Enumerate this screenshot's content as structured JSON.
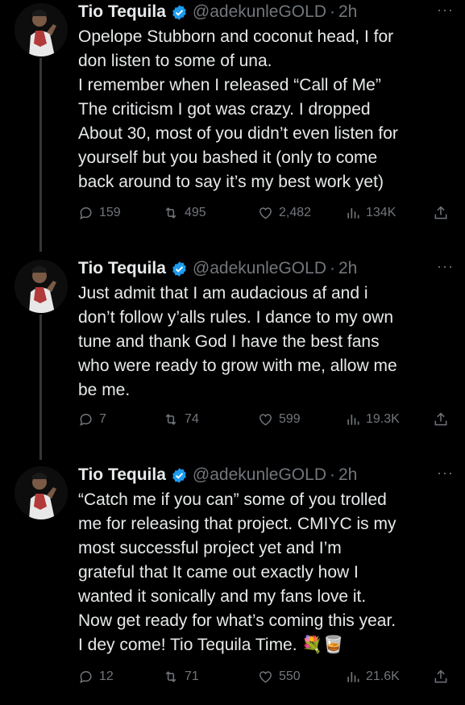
{
  "tweets": [
    {
      "name": "Tio Tequila",
      "handle": "@adekunleGOLD",
      "dot": "·",
      "time": "2h",
      "more": "···",
      "text": "Opelope Stubborn and coconut head, I for\ndon listen to some of una.\nI remember when I released “Call of Me”\nThe criticism I got was crazy. I dropped\nAbout 30, most of you didn’t even listen for\nyourself but you bashed it (only to come\nback around to say it’s my best work yet)",
      "replies": "159",
      "retweets": "495",
      "likes": "2,482",
      "views": "134K"
    },
    {
      "name": "Tio Tequila",
      "handle": "@adekunleGOLD",
      "dot": "·",
      "time": "2h",
      "more": "···",
      "text": "Just admit that I am audacious af and i\ndon’t follow y’alls rules. I dance to my own\ntune and thank God I have the best fans\nwho were ready to grow with me, allow me\nbe me.",
      "replies": "7",
      "retweets": "74",
      "likes": "599",
      "views": "19.3K"
    },
    {
      "name": "Tio Tequila",
      "handle": "@adekunleGOLD",
      "dot": "·",
      "time": "2h",
      "more": "···",
      "text": "“Catch me if you can” some of you trolled\nme for releasing that project. CMIYC is my\nmost successful project yet and I’m\ngrateful that It came out exactly how I\nwanted it sonically and my fans love it.\nNow get ready for what’s coming this year.\nI dey come! Tio Tequila Time. 💐🥃",
      "replies": "12",
      "retweets": "71",
      "likes": "550",
      "views": "21.6K"
    }
  ],
  "icons": {
    "verified": "verified-badge-icon",
    "reply": "reply-icon",
    "retweet": "retweet-icon",
    "like": "heart-icon",
    "views": "views-chart-icon",
    "share": "share-icon"
  },
  "colors": {
    "background": "#000000",
    "text": "#e7e9ea",
    "secondary": "#71767b",
    "verified": "#1d9bf0"
  }
}
